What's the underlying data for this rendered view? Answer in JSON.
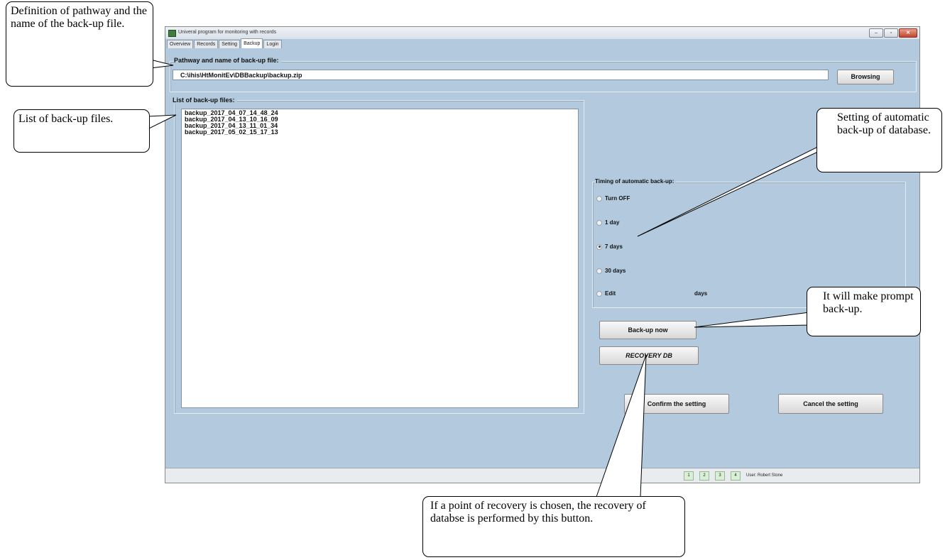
{
  "window": {
    "title": "Univeral program for monitoring with records",
    "buttons": {
      "minimize": "–",
      "maximize": "▫",
      "close": "✕"
    }
  },
  "tabs": [
    {
      "label": "Overview",
      "active": false
    },
    {
      "label": "Records",
      "active": false
    },
    {
      "label": "Setting",
      "active": false
    },
    {
      "label": "Backup",
      "active": true
    },
    {
      "label": "Login",
      "active": false
    }
  ],
  "backup_path": {
    "label": "Pathway and name of back-up file:",
    "value": "C:\\ihis\\HtMonitEv\\DBBackup\\backup.zip",
    "browse_label": "Browsing"
  },
  "backup_list": {
    "label": "List of back-up files:",
    "items": [
      "backup_2017_04_07_14_48_24",
      "backup_2017_04_13_10_16_09",
      "backup_2017_04_13_11_01_34",
      "backup_2017_05_02_15_17_13"
    ]
  },
  "timing": {
    "label": "Timing of automatic back-up:",
    "options": [
      {
        "label": "Turn OFF",
        "selected": false
      },
      {
        "label": "1 day",
        "selected": false
      },
      {
        "label": "7 days",
        "selected": true
      },
      {
        "label": "30 days",
        "selected": false
      },
      {
        "label": "Edit",
        "selected": false
      }
    ],
    "edit_unit": "days"
  },
  "actions": {
    "backup_now": "Back-up now",
    "recovery": "RECOVERY DB",
    "confirm": "Confirm the setting",
    "cancel": "Cancel the setting"
  },
  "statusbar": {
    "boxes": [
      "1",
      "2",
      "3",
      "4"
    ],
    "user": "User: Robert Stone"
  },
  "callouts": {
    "path": "Definition of pathway and the name of the back-up file.",
    "list": "List of back-up files.",
    "auto": "Setting of automatic back-up of database.",
    "prompt": "It will make prompt back-up.",
    "recovery": "If a point of recovery is chosen, the recovery of databse is performed by this button."
  },
  "colors": {
    "window_bg": "#b3cade",
    "statusbar_box": "#d9efd6"
  }
}
